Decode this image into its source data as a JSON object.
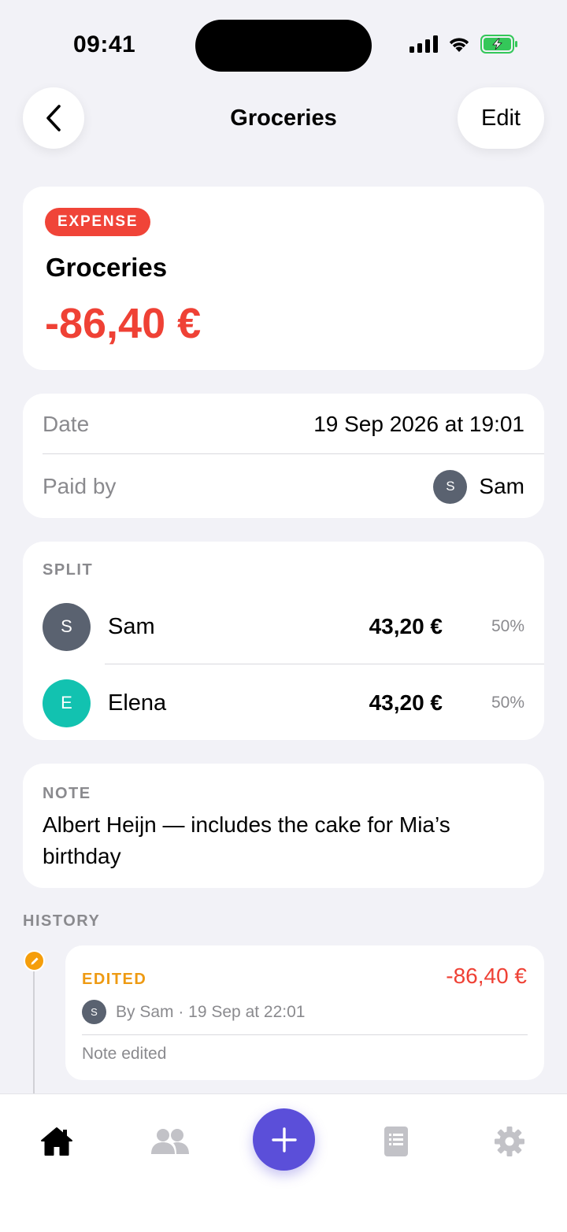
{
  "status_bar": {
    "time": "09:41"
  },
  "nav": {
    "title": "Groceries",
    "edit_label": "Edit"
  },
  "summary": {
    "badge": "EXPENSE",
    "title": "Groceries",
    "amount": "-86,40 €"
  },
  "details": {
    "date_label": "Date",
    "date_value": "19 Sep 2026 at 19:01",
    "paid_by_label": "Paid by",
    "paid_by_initial": "S",
    "paid_by_name": "Sam"
  },
  "split": {
    "label": "SPLIT",
    "rows": [
      {
        "initial": "S",
        "name": "Sam",
        "amount": "43,20 €",
        "percent": "50%",
        "color": "#5a6270"
      },
      {
        "initial": "E",
        "name": "Elena",
        "amount": "43,20 €",
        "percent": "50%",
        "color": "#12c2b0"
      }
    ]
  },
  "note": {
    "label": "NOTE",
    "text": "Albert Heijn — includes the cake for Mia’s birthday"
  },
  "history": {
    "label": "HISTORY",
    "entries": [
      {
        "type": "EDITED",
        "amount": "-86,40 €",
        "initial": "S",
        "meta": "By Sam · 19 Sep at 22:01",
        "description": "Note edited"
      }
    ]
  },
  "tab_bar": {
    "icons": [
      "home-icon",
      "people-icon",
      "plus-icon",
      "list-icon",
      "gear-icon"
    ]
  },
  "colors": {
    "accent": "#5b4fd9",
    "expense_red": "#ef4135",
    "edited_orange": "#f59e0b",
    "background": "#f2f2f7"
  }
}
